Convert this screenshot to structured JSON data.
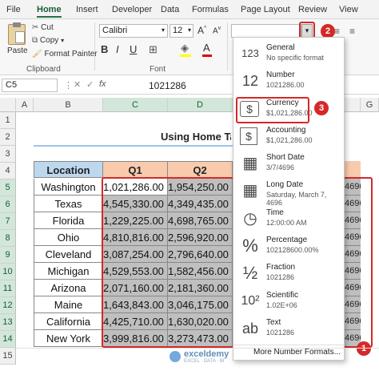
{
  "menu": {
    "tabs": [
      "File",
      "Home",
      "Insert",
      "Developer",
      "Data",
      "Formulas",
      "Page Layout",
      "Review",
      "View"
    ]
  },
  "ribbon": {
    "paste_label": "Paste",
    "cut_label": "Cut",
    "copy_label": "Copy",
    "format_painter_label": "Format Painter",
    "clipboard_label": "Clipboard",
    "font_name": "Calibri",
    "font_size": "12",
    "bold": "B",
    "italic": "I",
    "underline": "U",
    "font_label": "Font",
    "number_format_value": ""
  },
  "formula_bar": {
    "name_box": "C5",
    "fx": "fx",
    "value": "1021286"
  },
  "columns": [
    "A",
    "B",
    "C",
    "D",
    "E",
    "F",
    "G"
  ],
  "rows": [
    "1",
    "2",
    "3",
    "4",
    "5",
    "6",
    "7",
    "8",
    "9",
    "10",
    "11",
    "12",
    "13",
    "14",
    "15"
  ],
  "sheet": {
    "title": "Using Home Tab",
    "headers": [
      "Location",
      "Q1",
      "Q2"
    ],
    "data": [
      {
        "location": "Washington",
        "q1": "1,021,286.00",
        "q2": "1,954,250.00"
      },
      {
        "location": "Texas",
        "q1": "4,545,330.00",
        "q2": "4,349,435.00"
      },
      {
        "location": "Florida",
        "q1": "1,229,225.00",
        "q2": "4,698,765.00"
      },
      {
        "location": "Ohio",
        "q1": "4,810,816.00",
        "q2": "2,596,920.00"
      },
      {
        "location": "Cleveland",
        "q1": "3,087,254.00",
        "q2": "2,796,640.00"
      },
      {
        "location": "Michigan",
        "q1": "4,529,553.00",
        "q2": "1,582,456.00"
      },
      {
        "location": "Arizona",
        "q1": "2,071,160.00",
        "q2": "2,181,360.00"
      },
      {
        "location": "Maine",
        "q1": "1,643,843.00",
        "q2": "3,046,175.00"
      },
      {
        "location": "California",
        "q1": "4,425,710.00",
        "q2": "1,630,020.00"
      },
      {
        "location": "New York",
        "q1": "3,999,816.00",
        "q2": "3,273,473.00"
      }
    ]
  },
  "number_format_menu": {
    "items": [
      {
        "name": "General",
        "example": "No specific format",
        "icon": "123"
      },
      {
        "name": "Number",
        "example": "1021286.00",
        "icon": "12"
      },
      {
        "name": "Currency",
        "example": "$1,021,286.00",
        "icon": "$"
      },
      {
        "name": "Accounting",
        "example": "$1,021,286.00",
        "icon": "$"
      },
      {
        "name": "Short Date",
        "example": "3/7/4696",
        "icon": "▦"
      },
      {
        "name": "Long Date",
        "example": "Saturday, March 7, 4696",
        "icon": "▦"
      },
      {
        "name": "Time",
        "example": "12:00:00 AM",
        "icon": "◷"
      },
      {
        "name": "Percentage",
        "example": "102128600.00%",
        "icon": "%"
      },
      {
        "name": "Fraction",
        "example": "1021286",
        "icon": "½"
      },
      {
        "name": "Scientific",
        "example": "1.02E+06",
        "icon": "10²"
      },
      {
        "name": "Text",
        "example": "1021286",
        "icon": "ab"
      }
    ],
    "more_label": "More Number Formats..."
  },
  "partial_column_values": [
    "4696",
    "4696",
    "4696",
    "4696",
    "4696",
    "4696",
    "4696",
    "4696",
    "4696",
    "4696"
  ],
  "badges": [
    "1",
    "2",
    "3"
  ],
  "watermark": {
    "brand": "exceldemy",
    "tagline": "EXCEL · DATA · BI"
  },
  "colors": {
    "accent": "#217346",
    "highlight": "#d62828",
    "header_location": "#bdd7ee",
    "header_q": "#f8cbad",
    "q2_fill": "#bfbfbf"
  }
}
